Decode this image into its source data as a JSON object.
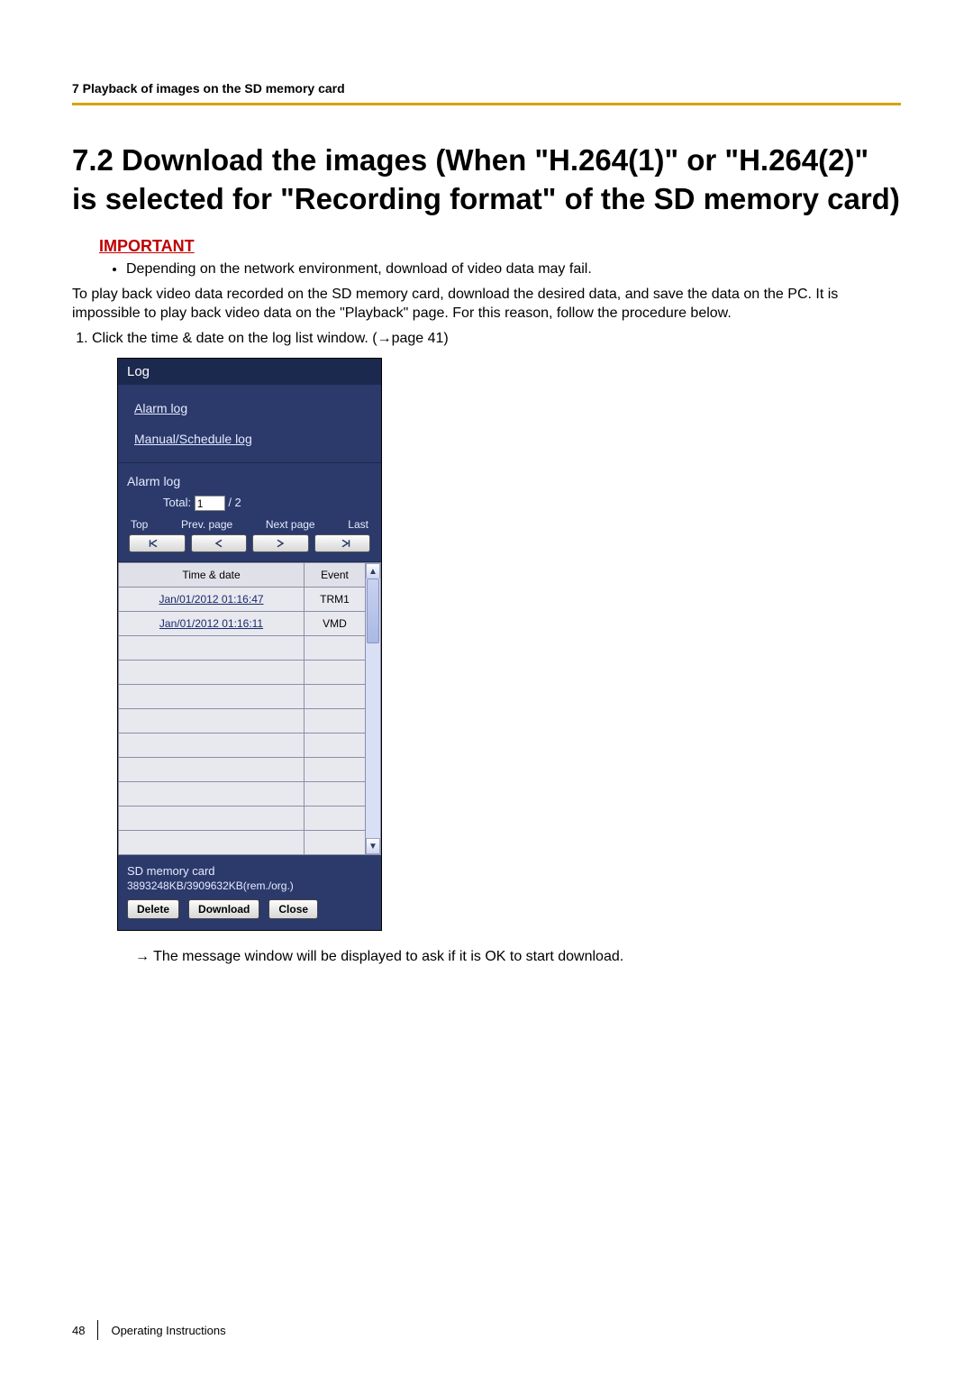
{
  "header": {
    "chapter": "7 Playback of images on the SD memory card"
  },
  "section": {
    "number_title": "7.2  Download the images (When \"H.264(1)\" or \"H.264(2)\" is selected for \"Recording format\" of the SD memory card)"
  },
  "important": {
    "label": "IMPORTANT",
    "bullet": "Depending on the network environment, download of video data may fail."
  },
  "intro": "To play back video data recorded on the SD memory card, download the desired data, and save the data on the PC. It is impossible to play back video data on the \"Playback\" page. For this reason, follow the procedure below.",
  "steps": [
    {
      "text": "Click the time & date on the log list window. (→page 41)"
    }
  ],
  "log_panel": {
    "title": "Log",
    "links": {
      "alarm": "Alarm log",
      "manual": "Manual/Schedule log"
    },
    "nav": {
      "section_title": "Alarm log",
      "total_label": "Total:",
      "page_current": "1",
      "page_total": "/ 2",
      "labels": {
        "top": "Top",
        "prev": "Prev. page",
        "next": "Next page",
        "last": "Last"
      }
    },
    "table": {
      "headers": {
        "time": "Time & date",
        "event": "Event"
      },
      "rows": [
        {
          "time": "Jan/01/2012 01:16:47",
          "event": "TRM1"
        },
        {
          "time": "Jan/01/2012 01:16:11",
          "event": "VMD"
        }
      ],
      "empty_rows": 9
    },
    "sd": {
      "title": "SD memory card",
      "size": "3893248KB/3909632KB(rem./org.)",
      "actions": {
        "delete": "Delete",
        "download": "Download",
        "close": "Close"
      }
    }
  },
  "result_arrow": "→",
  "result_text": "The message window will be displayed to ask if it is OK to start download.",
  "footer": {
    "page_no": "48",
    "doc": "Operating Instructions"
  }
}
